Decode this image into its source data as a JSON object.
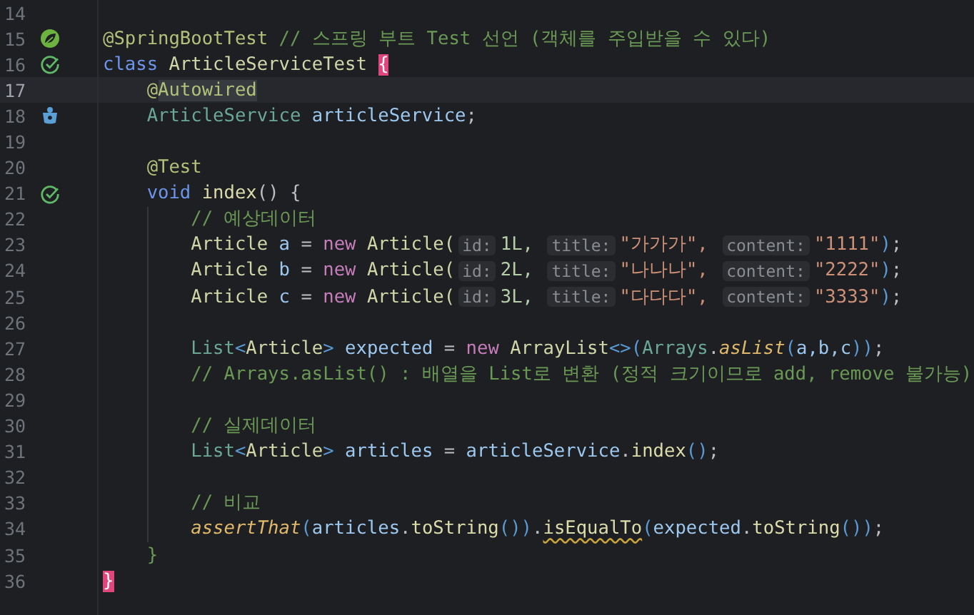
{
  "editor": {
    "lines": [
      {
        "number": "14",
        "current": false
      },
      {
        "number": "15",
        "current": false,
        "icon": {
          "kind": "spring"
        },
        "tokens": [
          {
            "t": "@SpringBootTest ",
            "kind": "annotation"
          },
          {
            "t": "// 스프링 부트 Test 선언 (객체를 주입받을 수 있다)",
            "kind": "comment"
          }
        ]
      },
      {
        "number": "16",
        "current": false,
        "icon": {
          "kind": "run"
        },
        "tokens": [
          {
            "t": "class ",
            "kind": "keyword"
          },
          {
            "t": "ArticleServiceTest ",
            "kind": "class"
          },
          {
            "t": "{",
            "kind": "brace-match"
          }
        ],
        "children": [
          {
            "number": "17",
            "current": true,
            "tokens": [
              {
                "t": "@",
                "kind": "annotation"
              },
              {
                "t": "Autowired",
                "kind": "annotation-usage"
              }
            ]
          },
          {
            "number": "18",
            "current": false,
            "icon": {
              "kind": "bean"
            },
            "tokens": [
              {
                "t": "ArticleService ",
                "kind": "type"
              },
              {
                "t": "articleService",
                "kind": "field"
              },
              {
                "t": ";",
                "kind": "punct"
              }
            ]
          },
          {
            "number": "19",
            "current": false
          },
          {
            "number": "20",
            "current": false,
            "tokens": [
              {
                "t": "@Test",
                "kind": "annotation"
              }
            ]
          },
          {
            "number": "21",
            "current": false,
            "icon": {
              "kind": "run"
            },
            "tokens": [
              {
                "t": "void ",
                "kind": "keyword"
              },
              {
                "t": "index",
                "kind": "method"
              },
              {
                "t": "() {",
                "kind": "punct"
              }
            ],
            "children": [
              {
                "number": "22",
                "current": false,
                "tokens": [
                  {
                    "t": "// 예상데이터",
                    "kind": "comment"
                  }
                ]
              },
              {
                "number": "23",
                "current": false,
                "tokens": [
                  {
                    "t": "Article ",
                    "kind": "class"
                  },
                  {
                    "t": "a",
                    "kind": "variable"
                  },
                  {
                    "t": " = ",
                    "kind": "punct"
                  },
                  {
                    "t": "new ",
                    "kind": "keyword-new"
                  },
                  {
                    "t": "Article(",
                    "kind": "class"
                  },
                  {
                    "t": "id:",
                    "kind": "hint"
                  },
                  {
                    "t": "1L,",
                    "kind": "number"
                  },
                  {
                    "t": "title:",
                    "kind": "hint"
                  },
                  {
                    "t": "\"가가가\",",
                    "kind": "string"
                  },
                  {
                    "t": "content:",
                    "kind": "hint"
                  },
                  {
                    "t": "\"1111\"",
                    "kind": "string"
                  },
                  {
                    "t": ")",
                    "kind": "bracket"
                  },
                  {
                    "t": ";",
                    "kind": "punct"
                  }
                ]
              },
              {
                "number": "24",
                "current": false,
                "tokens": [
                  {
                    "t": "Article ",
                    "kind": "class"
                  },
                  {
                    "t": "b",
                    "kind": "variable"
                  },
                  {
                    "t": " = ",
                    "kind": "punct"
                  },
                  {
                    "t": "new ",
                    "kind": "keyword-new"
                  },
                  {
                    "t": "Article(",
                    "kind": "class"
                  },
                  {
                    "t": "id:",
                    "kind": "hint"
                  },
                  {
                    "t": "2L,",
                    "kind": "number"
                  },
                  {
                    "t": "title:",
                    "kind": "hint"
                  },
                  {
                    "t": "\"나나나\",",
                    "kind": "string"
                  },
                  {
                    "t": "content:",
                    "kind": "hint"
                  },
                  {
                    "t": "\"2222\"",
                    "kind": "string"
                  },
                  {
                    "t": ")",
                    "kind": "bracket"
                  },
                  {
                    "t": ";",
                    "kind": "punct"
                  }
                ]
              },
              {
                "number": "25",
                "current": false,
                "tokens": [
                  {
                    "t": "Article ",
                    "kind": "class"
                  },
                  {
                    "t": "c",
                    "kind": "variable"
                  },
                  {
                    "t": " = ",
                    "kind": "punct"
                  },
                  {
                    "t": "new ",
                    "kind": "keyword-new"
                  },
                  {
                    "t": "Article(",
                    "kind": "class"
                  },
                  {
                    "t": "id:",
                    "kind": "hint"
                  },
                  {
                    "t": "3L,",
                    "kind": "number"
                  },
                  {
                    "t": "title:",
                    "kind": "hint"
                  },
                  {
                    "t": "\"다다다\",",
                    "kind": "string"
                  },
                  {
                    "t": "content:",
                    "kind": "hint"
                  },
                  {
                    "t": "\"3333\"",
                    "kind": "string"
                  },
                  {
                    "t": ")",
                    "kind": "bracket"
                  },
                  {
                    "t": ";",
                    "kind": "punct"
                  }
                ]
              },
              {
                "number": "26",
                "current": false
              },
              {
                "number": "27",
                "current": false,
                "tokens": [
                  {
                    "t": "List",
                    "kind": "type"
                  },
                  {
                    "t": "<",
                    "kind": "bracket"
                  },
                  {
                    "t": "Article",
                    "kind": "class"
                  },
                  {
                    "t": ">",
                    "kind": "bracket"
                  },
                  {
                    "t": " expected",
                    "kind": "variable"
                  },
                  {
                    "t": " = ",
                    "kind": "punct"
                  },
                  {
                    "t": "new ",
                    "kind": "keyword-new"
                  },
                  {
                    "t": "ArrayList",
                    "kind": "class"
                  },
                  {
                    "t": "<>(",
                    "kind": "bracket"
                  },
                  {
                    "t": "Arrays",
                    "kind": "type"
                  },
                  {
                    "t": ".",
                    "kind": "punct"
                  },
                  {
                    "t": "asList",
                    "kind": "static-method"
                  },
                  {
                    "t": "(",
                    "kind": "bracket"
                  },
                  {
                    "t": "a,b,c",
                    "kind": "variable"
                  },
                  {
                    "t": "))",
                    "kind": "bracket"
                  },
                  {
                    "t": ";",
                    "kind": "punct"
                  }
                ]
              },
              {
                "number": "28",
                "current": false,
                "tokens": [
                  {
                    "t": "// Arrays.asList() : 배열을 List로 변환 (정적 크기이므로 add, remove 불가능)",
                    "kind": "comment"
                  }
                ]
              },
              {
                "number": "29",
                "current": false
              },
              {
                "number": "30",
                "current": false,
                "tokens": [
                  {
                    "t": "// 실제데이터",
                    "kind": "comment"
                  }
                ]
              },
              {
                "number": "31",
                "current": false,
                "tokens": [
                  {
                    "t": "List",
                    "kind": "type"
                  },
                  {
                    "t": "<",
                    "kind": "bracket"
                  },
                  {
                    "t": "Article",
                    "kind": "class"
                  },
                  {
                    "t": ">",
                    "kind": "bracket"
                  },
                  {
                    "t": " articles",
                    "kind": "variable"
                  },
                  {
                    "t": " = ",
                    "kind": "punct"
                  },
                  {
                    "t": "articleService",
                    "kind": "variable"
                  },
                  {
                    "t": ".",
                    "kind": "punct"
                  },
                  {
                    "t": "index",
                    "kind": "method"
                  },
                  {
                    "t": "()",
                    "kind": "bracket"
                  },
                  {
                    "t": ";",
                    "kind": "punct"
                  }
                ]
              },
              {
                "number": "32",
                "current": false
              },
              {
                "number": "33",
                "current": false,
                "tokens": [
                  {
                    "t": "// 비교",
                    "kind": "comment"
                  }
                ]
              },
              {
                "number": "34",
                "current": false,
                "tokens": [
                  {
                    "t": "assertThat",
                    "kind": "static-method"
                  },
                  {
                    "t": "(",
                    "kind": "bracket"
                  },
                  {
                    "t": "articles",
                    "kind": "variable"
                  },
                  {
                    "t": ".",
                    "kind": "punct"
                  },
                  {
                    "t": "toString",
                    "kind": "method"
                  },
                  {
                    "t": "())",
                    "kind": "bracket"
                  },
                  {
                    "t": ".",
                    "kind": "punct"
                  },
                  {
                    "t": "isEqualTo",
                    "kind": "method-warning"
                  },
                  {
                    "t": "(",
                    "kind": "bracket"
                  },
                  {
                    "t": "expected",
                    "kind": "variable"
                  },
                  {
                    "t": ".",
                    "kind": "punct"
                  },
                  {
                    "t": "toString",
                    "kind": "method"
                  },
                  {
                    "t": "())",
                    "kind": "bracket"
                  },
                  {
                    "t": ";",
                    "kind": "punct"
                  }
                ]
              }
            ]
          },
          {
            "number": "35",
            "current": false,
            "tokens": [
              {
                "t": "}",
                "kind": "block-brace"
              }
            ]
          }
        ]
      },
      {
        "number": "36",
        "current": false,
        "tokens": [
          {
            "t": "}",
            "kind": "brace-match"
          }
        ]
      }
    ]
  }
}
